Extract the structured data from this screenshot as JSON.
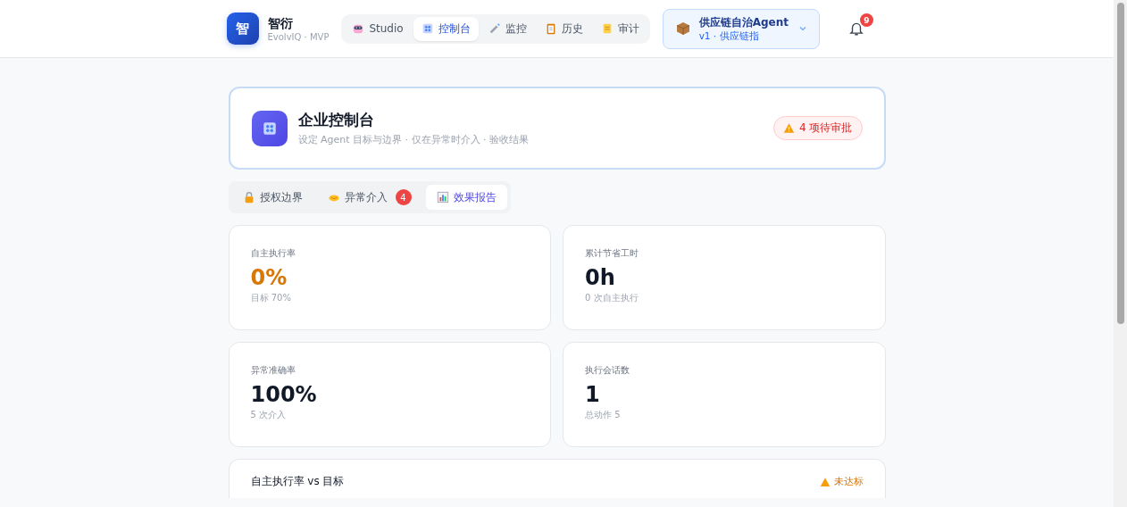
{
  "brand": {
    "logo": "智",
    "name": "智衍",
    "subtitle": "EvolvIQ · MVP"
  },
  "nav": [
    {
      "label": "Studio",
      "selected": false
    },
    {
      "label": "控制台",
      "selected": true
    },
    {
      "label": "监控",
      "selected": false
    },
    {
      "label": "历史",
      "selected": false
    },
    {
      "label": "审计",
      "selected": false
    }
  ],
  "agent": {
    "name": "供应链自治Agent",
    "meta": "v1 · 供应链指"
  },
  "notifications": {
    "count": "9"
  },
  "header": {
    "title": "企业控制台",
    "subtitle": "设定 Agent 目标与边界 · 仅在异常时介入 · 验收结果",
    "alert": "4 项待审批"
  },
  "tabs": [
    {
      "label": "授权边界",
      "selected": false
    },
    {
      "label": "异常介入",
      "selected": false,
      "badge": "4"
    },
    {
      "label": "效果报告",
      "selected": true
    }
  ],
  "stats": [
    {
      "label": "自主执行率",
      "value": "0%",
      "note": "目标 70%",
      "color": "#d97706"
    },
    {
      "label": "累计节省工时",
      "value": "0h",
      "note": "0 次自主执行",
      "color": "#111827"
    },
    {
      "label": "异常准确率",
      "value": "100%",
      "note": "5 次介入",
      "color": "#111827"
    },
    {
      "label": "执行会话数",
      "value": "1",
      "note": "总动作 5",
      "color": "#111827"
    }
  ],
  "chart_card": {
    "title": "自主执行率 vs 目标",
    "status": "未达标"
  }
}
